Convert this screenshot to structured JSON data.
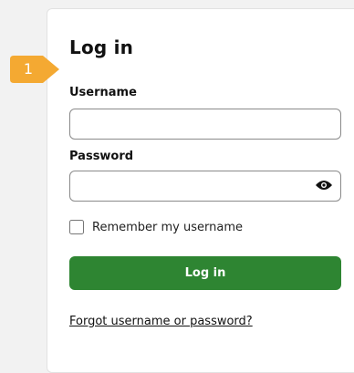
{
  "annotation": {
    "step_number": "1",
    "color": "#f4a932"
  },
  "login": {
    "title": "Log in",
    "username_label": "Username",
    "username_value": "",
    "password_label": "Password",
    "password_value": "",
    "remember_label": "Remember my username",
    "remember_checked": false,
    "submit_label": "Log in",
    "forgot_link": "Forgot username or password?"
  },
  "colors": {
    "primary_button": "#2e8532",
    "card_bg": "#ffffff",
    "page_bg": "#f2f2f2"
  },
  "icons": {
    "password_toggle": "eye-icon"
  }
}
